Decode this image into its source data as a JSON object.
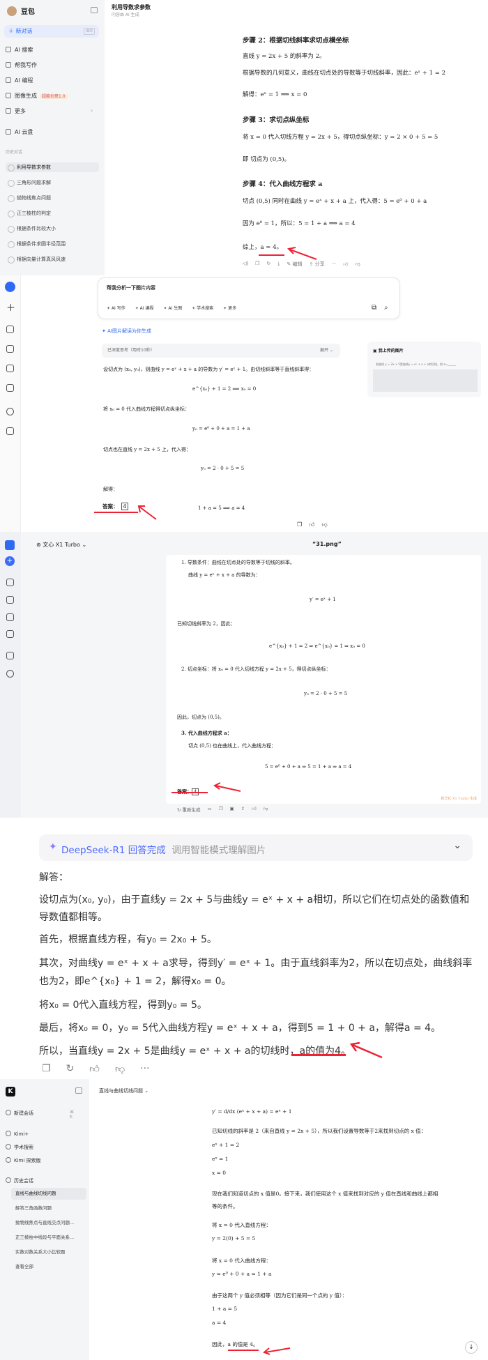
{
  "doubao": {
    "app_name": "豆包",
    "new_chat": "新对话",
    "new_chat_kbd": "⌘K",
    "nav": [
      "AI 搜索",
      "帮我写作",
      "AI 编程",
      "图像生成",
      "更多",
      "AI 云盘"
    ],
    "image_badge": "超能创意1.0",
    "history_label": "历史对话",
    "history": [
      "利用导数求参数",
      "三角形问题求解",
      "抛物线焦点问题",
      "正三棱柱的判定",
      "根据条件比较大小",
      "根据条件求圆半径范围",
      "根据向量计算真风风速"
    ],
    "chat_title": "利用导数求参数",
    "chat_sub": "内容由 AI 生成",
    "lines": [
      "步骤 2：根据切线斜率求切点横坐标",
      "直线 y = 2x + 5 的斜率为 2。",
      "根据导数的几何意义，曲线在切点处的导数等于切线斜率，因此：eˣ + 1 = 2",
      "解得：eˣ = 1  ⟹  x = 0",
      "步骤 3：求切点纵坐标",
      "将 x = 0 代入切线方程 y = 2x + 5，得切点纵坐标：y = 2 × 0 + 5 = 5",
      "即 切点为 (0,5)。",
      "步骤 4：代入曲线方程求 a",
      "切点 (0,5) 同时在曲线 y = eˣ + x + a 上，代入得：5 = e⁰ + 0 + a",
      "因为 e⁰ = 1，所以：5 = 1 + a  ⟹  a = 4",
      "综上，a = 4。"
    ],
    "toolbar": [
      "编辑",
      "分享"
    ]
  },
  "yuanbao": {
    "input_text": "帮我分析一下图片内容",
    "chips": [
      "AI 写作",
      "AI 编程",
      "AI 生图",
      "学术搜索",
      "更多"
    ],
    "ai_tag": "AI图片解读为你生成",
    "think_label": "已深度思考（用时10秒）",
    "expand": "展开",
    "uploaded_title": "我上传的图片",
    "uploaded_text": "若曲线 y = 2x + 5是曲线y = eˣ + x + a的切线，则 a=______",
    "lines": [
      "设切点为 (x₀, y₀)，则曲线 y = eˣ + x + a 的导数为 y′ = eˣ + 1。由切线斜率等于直线斜率得：",
      "e^{x₀} + 1 = 2  ⟹  x₀ = 0",
      "将 x₀ = 0 代入曲线方程得切点纵坐标：",
      "y₀ = e⁰ + 0 + a = 1 + a",
      "切点也在直线 y = 2x + 5 上，代入得：",
      "y₀ = 2 · 0 + 5 = 5",
      "解得：",
      "1 + a = 5  ⟹  a = 4"
    ],
    "answer_label": "答案：",
    "answer_value": "4"
  },
  "wenxin": {
    "model": "文心 X1 Turbo",
    "file": "“31.png”",
    "lines": [
      "1. 导数条件：曲线在切点处的导数等于切线的斜率。",
      "曲线 y = eˣ + x + a 的导数为：",
      "y′ = eˣ + 1",
      "已知切线斜率为 2，因此：",
      "e^{x₀} + 1 = 2   ⇒   e^{x₀} = 1   ⇒   x₀ = 0",
      "2. 切点坐标：将 x₀ = 0 代入切线方程 y = 2x + 5，得切点纵坐标：",
      "y₀ = 2 · 0 + 5 = 5",
      "因此，切点为 (0,5)。",
      "3. 代入曲线方程求 a：",
      "切点 (0,5) 也在曲线上，代入曲线方程：",
      "5 = e⁰ + 0 + a   ⇒   5 = 1 + a   ⇒   a = 4"
    ],
    "answer_label": "答案：",
    "answer_value": "4",
    "watermark": "新华社 X1 Turbo 生成",
    "regen": "重新生成"
  },
  "deepseek": {
    "header": "DeepSeek-R1 回答完成",
    "header_sub": "调用智能模式理解图片",
    "lines": [
      "解答：",
      "设切点为(x₀, y₀)，由于直线y = 2x + 5与曲线y = eˣ + x + a相切，所以它们在切点处的函数值和",
      "导数值都相等。",
      "首先，根据直线方程，有y₀ = 2x₀ + 5。",
      "其次，对曲线y = eˣ + x + a求导，得到y′ = eˣ + 1。由于直线斜率为2，所以在切点处，曲线斜率",
      "也为2，即e^{x₀} + 1 = 2，解得x₀ = 0。",
      "将x₀ = 0代入直线方程，得到y₀ = 5。",
      "最后，将x₀ = 0，y₀ = 5代入曲线方程y = eˣ + x + a，得到5 = 1 + 0 + a，解得a = 4。",
      "所以，当直线y = 2x + 5是曲线y = eˣ + x + a的切线时，a的值为4。"
    ]
  },
  "kimi": {
    "new_chat": "新建会话",
    "kbd": "⌘ K",
    "nav": [
      "Kimi+",
      "学术搜索",
      "Kimi 探索版"
    ],
    "history_label": "历史会话",
    "history": [
      "直线与曲线切线问题",
      "解答三角函数问题",
      "抛物线焦点与直线交点问题...",
      "正三棱柱中线段与平面关系...",
      "实数对数关系大小比较题",
      "查看全部"
    ],
    "title": "直线与曲线切线问题 ⌄",
    "lines": [
      "y′ = d/dx (eˣ + x + a) = eˣ + 1",
      "已知切线的斜率是 2（来自直线 y = 2x + 5），所以我们设置导数等于2来找到切点的 x 值：",
      "eˣ + 1 = 2",
      "eˣ = 1",
      "x = 0",
      "现在我们知道切点的 x 值是0。接下来，我们使用这个 x 值来找到对应的 y 值在直线和曲线上都相",
      "等的条件。",
      "将 x = 0 代入直线方程：",
      "y = 2(0) + 5 = 5",
      "将 x = 0 代入曲线方程：",
      "y = e⁰ + 0 + a = 1 + a",
      "由于这两个 y 值必须相等（因为它们是同一个点的 y 值）：",
      "1 + a = 5",
      "a = 4",
      "因此，a 的值是 4。"
    ]
  },
  "colors": {
    "accent_blue": "#2f6bf2",
    "highlight_red": "#e23",
    "deepseek_blue": "#4d6bfe"
  }
}
